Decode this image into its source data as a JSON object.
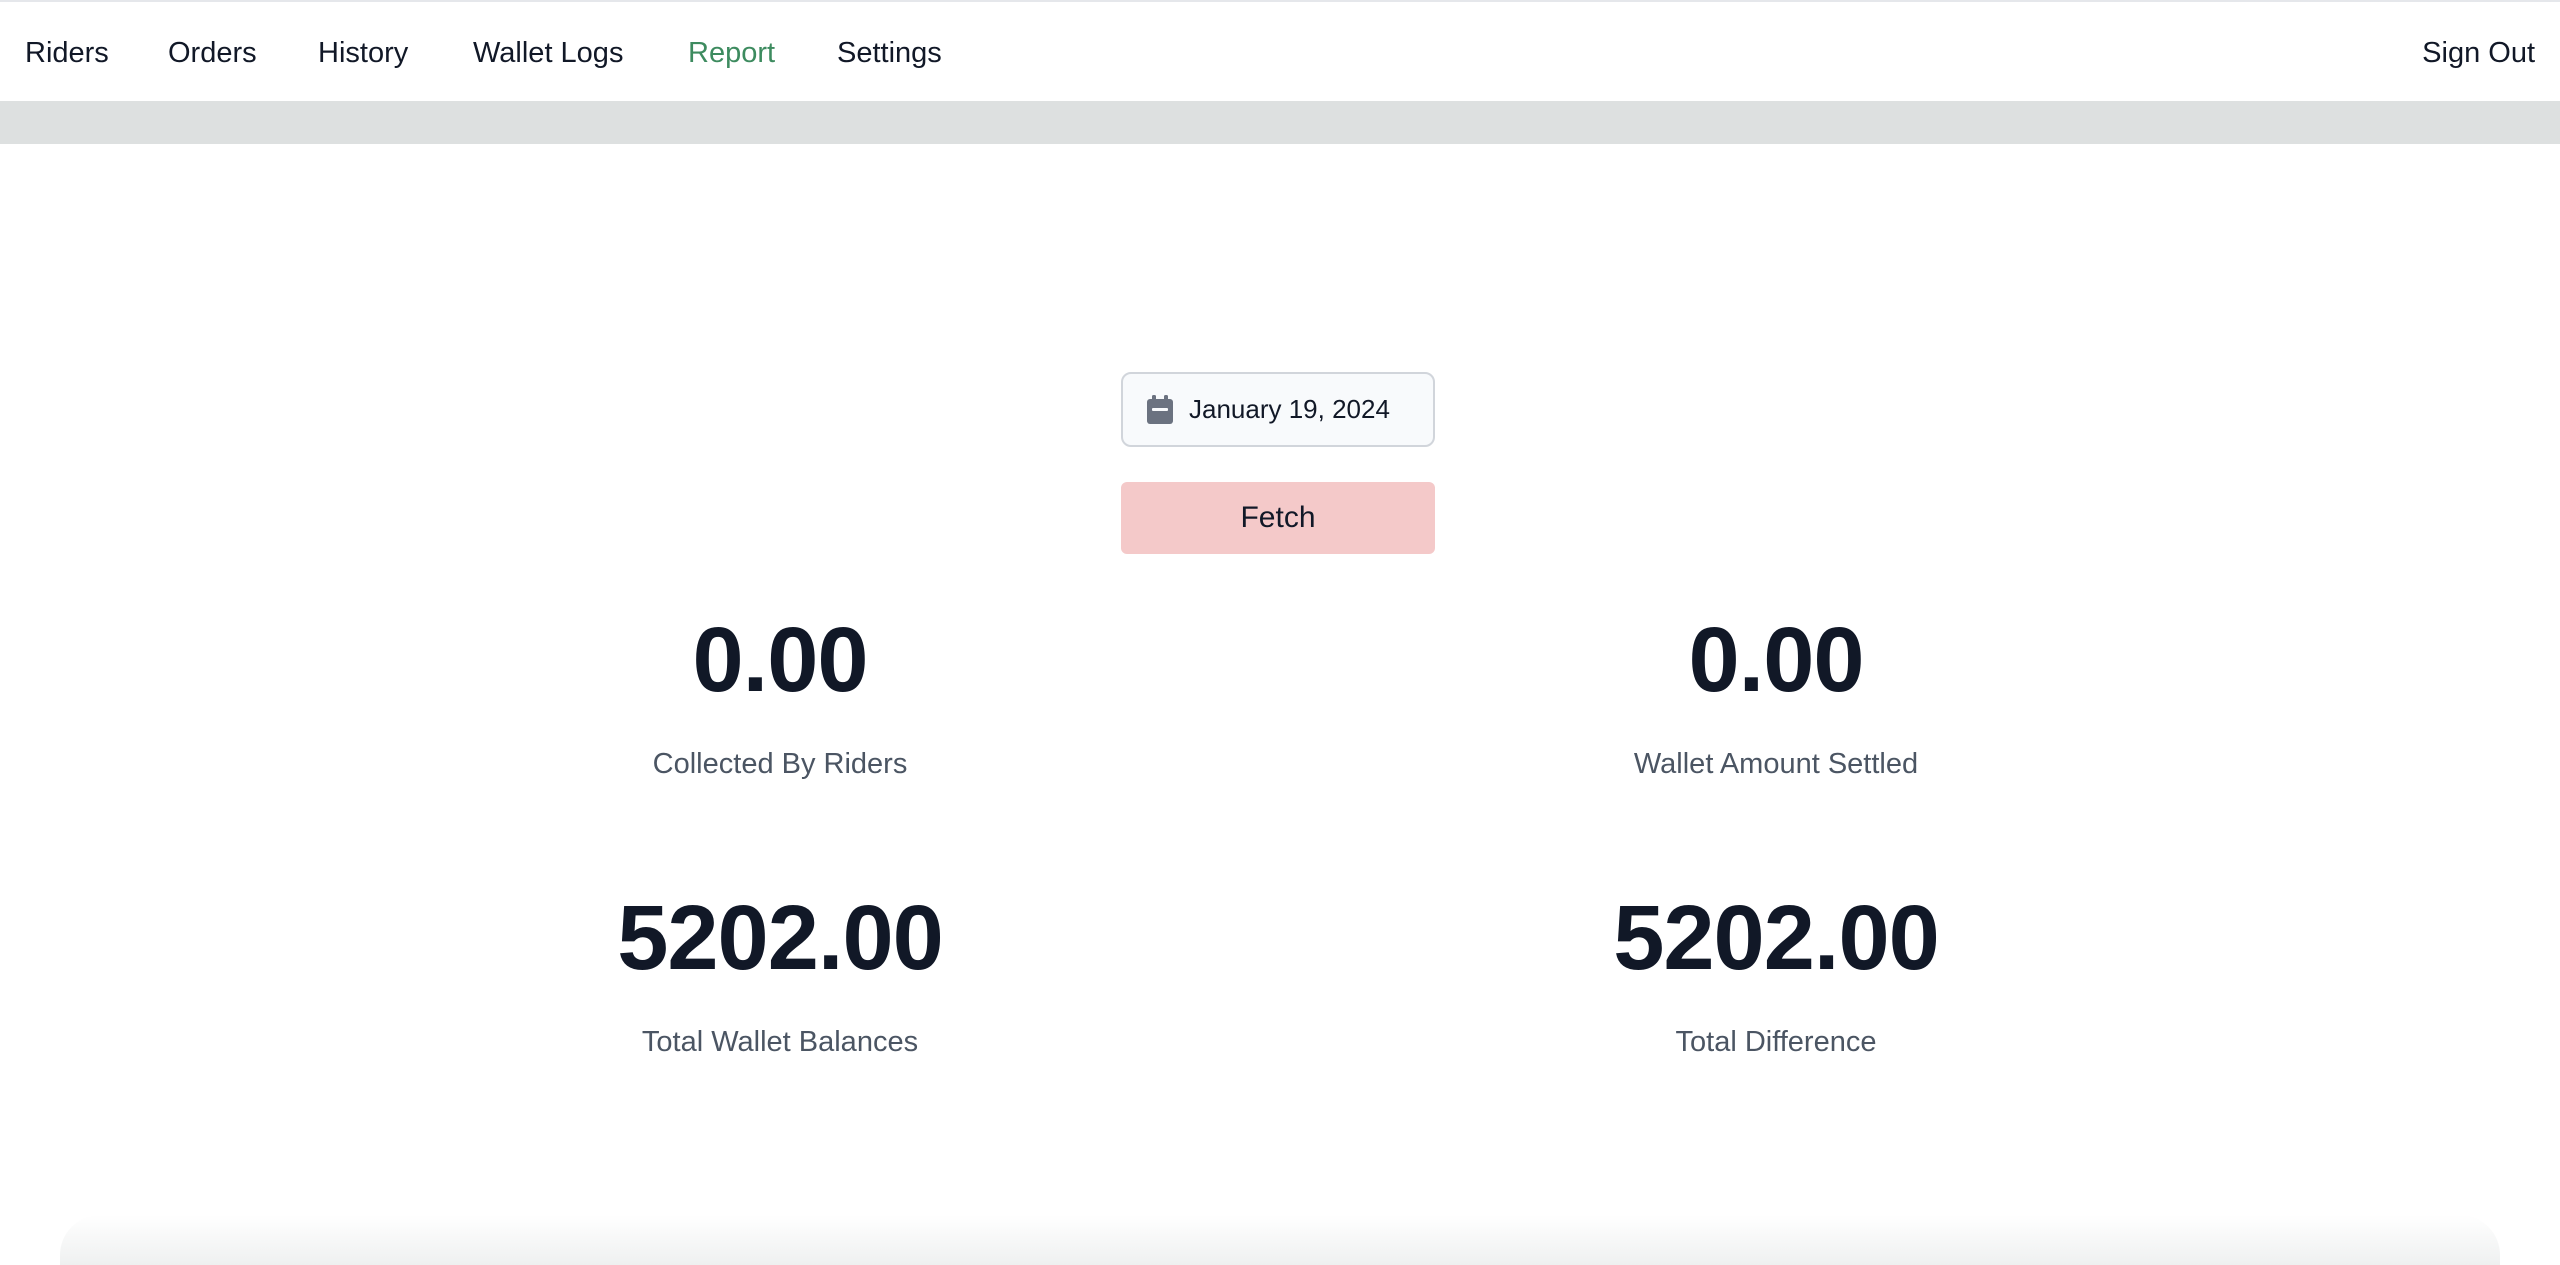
{
  "nav": {
    "links": [
      {
        "label": "Riders"
      },
      {
        "label": "Orders"
      },
      {
        "label": "History"
      },
      {
        "label": "Wallet Logs"
      },
      {
        "label": "Report",
        "active": true
      },
      {
        "label": "Settings"
      }
    ],
    "sign_out": "Sign Out",
    "active_color": "#3d8b5f"
  },
  "report": {
    "date_value": "January 19, 2024",
    "date_icon": "calendar-icon",
    "fetch_label": "Fetch",
    "fetch_color": "#f4c9c9",
    "stats": [
      {
        "value": "0.00",
        "label": "Collected By Riders"
      },
      {
        "value": "0.00",
        "label": "Wallet Amount Settled"
      },
      {
        "value": "5202.00",
        "label": "Total Wallet Balances"
      },
      {
        "value": "5202.00",
        "label": "Total Difference"
      }
    ]
  }
}
